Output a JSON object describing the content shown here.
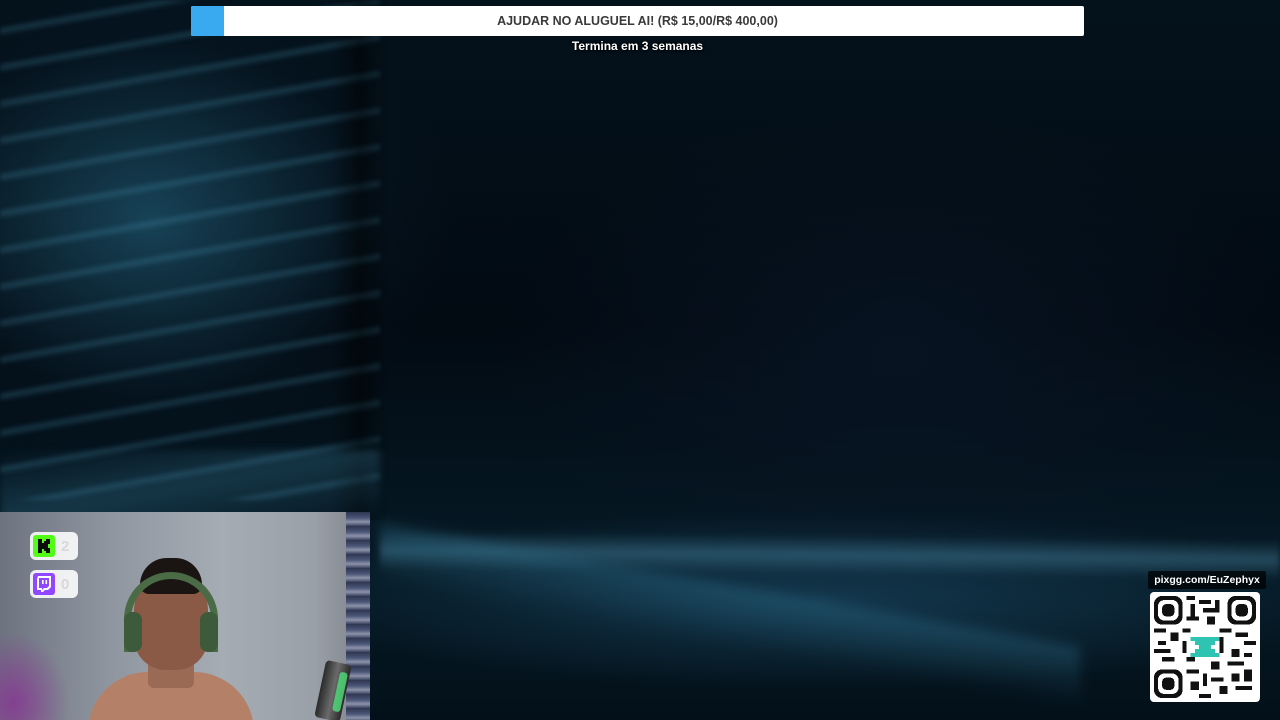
{
  "goal": {
    "label": "AJUDAR NO ALUGUEL AI! (R$ 15,00/R$ 400,00)",
    "progress": 0.0375,
    "subtitle": "Termina em 3 semanas",
    "fill_color": "#3aaaf0"
  },
  "platforms": [
    {
      "name": "kick",
      "icon": "kick-icon",
      "count": "2",
      "color": "#53fc18"
    },
    {
      "name": "twitch",
      "icon": "twitch-icon",
      "count": "0",
      "color": "#9146ff"
    }
  ],
  "qr": {
    "url": "pixgg.com/EuZephyx",
    "icon": "qr-code-icon"
  }
}
